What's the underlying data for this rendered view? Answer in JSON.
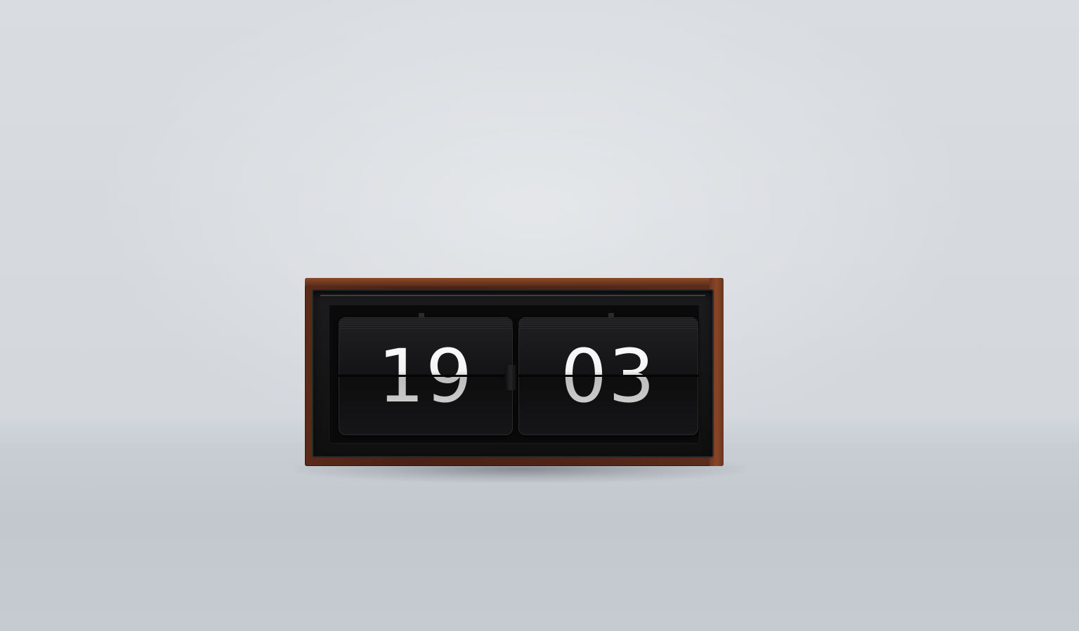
{
  "clock": {
    "hours": "19",
    "minutes": "03"
  },
  "colors": {
    "background": "#d3d7dc",
    "case": "#4f2416",
    "card": "#141416",
    "digit": "#f2f2f2"
  }
}
